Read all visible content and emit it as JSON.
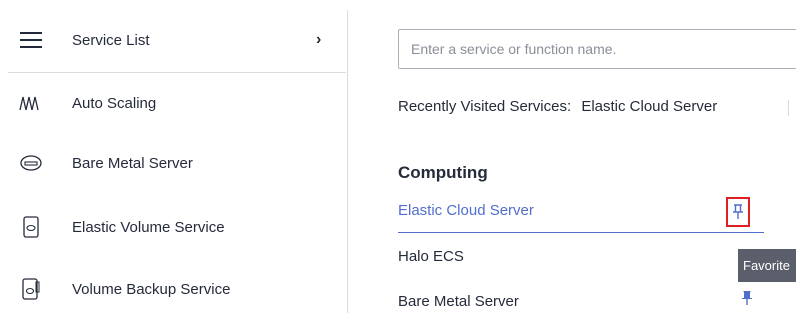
{
  "sidebar": {
    "items": [
      {
        "label": "Service List",
        "icon": "hamburger-menu-icon"
      },
      {
        "label": "Auto Scaling",
        "icon": "auto-scaling-icon"
      },
      {
        "label": "Bare Metal Server",
        "icon": "bare-metal-server-icon"
      },
      {
        "label": "Elastic Volume Service",
        "icon": "elastic-volume-icon"
      },
      {
        "label": "Volume Backup Service",
        "icon": "volume-backup-icon"
      }
    ],
    "chevron_icon": "chevron-right-icon"
  },
  "search": {
    "placeholder": "Enter a service or function name.",
    "value": ""
  },
  "recent": {
    "label": "Recently Visited Services:",
    "items": [
      "Elastic Cloud Server"
    ]
  },
  "category": {
    "title": "Computing",
    "services": [
      {
        "name": "Elastic Cloud Server",
        "state": "active",
        "pin": "outline"
      },
      {
        "name": "Halo ECS",
        "state": "normal"
      },
      {
        "name": "Bare Metal Server",
        "state": "normal",
        "pin": "filled"
      }
    ]
  },
  "tooltip": {
    "text": "Favorite"
  },
  "colors": {
    "link": "#526ecc",
    "text": "#252b3a",
    "highlight": "#e02020",
    "tooltip_bg": "#5b5f6b"
  }
}
